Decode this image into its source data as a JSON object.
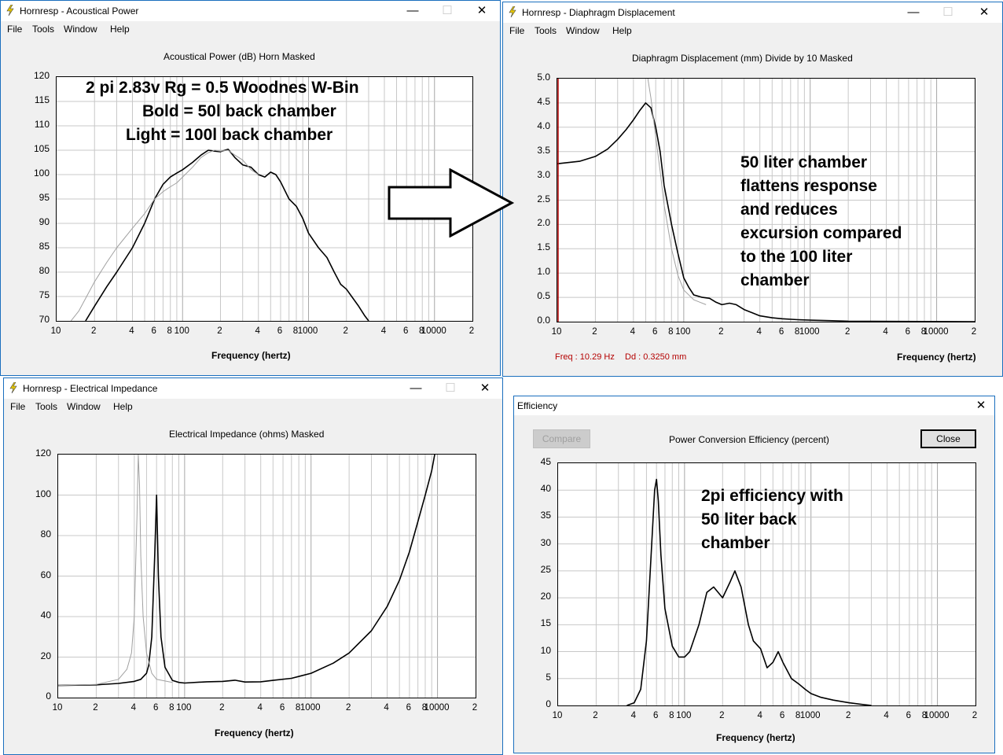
{
  "windows": {
    "acoustical": {
      "title": "Hornresp - Acoustical Power",
      "menu": [
        "File",
        "Tools",
        "Window",
        "Help"
      ],
      "chart_title": "Acoustical Power (dB)   Horn   Masked",
      "x_axis_title": "Frequency (hertz)",
      "annotation": [
        "2 pi 2.83v  Rg = 0.5  Woodnes W-Bin",
        "Bold = 50l back chamber",
        "Light = 100l back chamber"
      ]
    },
    "displacement": {
      "title": "Hornresp - Diaphragm Displacement",
      "menu": [
        "File",
        "Tools",
        "Window",
        "Help"
      ],
      "chart_title": "Diaphragm Displacement (mm)   Divide by 10   Masked",
      "x_axis_title": "Frequency (hertz)",
      "status_freq": "Freq : 10.29 Hz",
      "status_dd": "Dd : 0.3250 mm",
      "annotation": [
        "50 liter chamber",
        "flattens response",
        "and reduces",
        "excursion compared",
        "to the 100 liter",
        "chamber"
      ]
    },
    "impedance": {
      "title": "Hornresp - Electrical Impedance",
      "menu": [
        "File",
        "Tools",
        "Window",
        "Help"
      ],
      "chart_title": "Electrical Impedance (ohms)   Masked",
      "x_axis_title": "Frequency (hertz)"
    },
    "efficiency": {
      "title": "Efficiency",
      "chart_title": "Power Conversion Efficiency (percent)",
      "compare_label": "Compare",
      "close_label": "Close",
      "x_axis_title": "Frequency (hertz)",
      "annotation": [
        "2pi efficiency with",
        "50 liter back",
        "chamber"
      ]
    }
  },
  "colors": {
    "title_border": "#1a6fbe",
    "client_bg": "#f0f0f0",
    "grid": "#c8c8c8",
    "trace_bold": "#000000",
    "trace_light": "#a0a0a0",
    "status": "#b40000"
  },
  "x_tick_labels": [
    "10",
    "2",
    "4",
    "6",
    "8",
    "100",
    "2",
    "4",
    "6",
    "8",
    "1000",
    "2",
    "4",
    "6",
    "8",
    "10000",
    "2"
  ],
  "chart_data": [
    {
      "id": "acoustical",
      "type": "line",
      "title": "Acoustical Power (dB)   Horn   Masked",
      "xlabel": "Frequency (hertz)",
      "xscale": "log",
      "xlim": [
        10,
        20000
      ],
      "ylim": [
        70,
        120
      ],
      "y_ticks": [
        "120",
        "115",
        "110",
        "105",
        "100",
        "95",
        "90",
        "85",
        "80",
        "75",
        "70"
      ],
      "grid": true,
      "series": [
        {
          "style": "bold",
          "x": [
            17,
            20,
            25,
            30,
            40,
            50,
            60,
            70,
            80,
            90,
            100,
            120,
            140,
            160,
            180,
            200,
            230,
            260,
            300,
            350,
            400,
            450,
            500,
            550,
            600,
            700,
            800,
            900,
            1000,
            1200,
            1400,
            1600,
            1800,
            2000,
            2200,
            2500,
            2800,
            3000
          ],
          "y": [
            70,
            73,
            77,
            80,
            85,
            90,
            95,
            98,
            99.5,
            100.3,
            101,
            102.5,
            104,
            105,
            104.8,
            104.7,
            105.2,
            103.5,
            102,
            101.5,
            100,
            99.5,
            100.5,
            100,
            98.5,
            95,
            93.5,
            91,
            88,
            85,
            83,
            80,
            77.5,
            76.5,
            75,
            73,
            71,
            70
          ]
        },
        {
          "style": "light",
          "x": [
            13,
            15,
            20,
            25,
            30,
            40,
            50,
            60,
            70,
            80,
            90,
            100,
            120,
            140,
            160,
            180,
            200,
            230,
            260,
            300,
            350,
            400
          ],
          "y": [
            70,
            72,
            78,
            82,
            85,
            89,
            92,
            95,
            96.5,
            97.5,
            98.3,
            99.5,
            101.5,
            103.5,
            104.5,
            105,
            104.8,
            105,
            104,
            103,
            101,
            100
          ]
        }
      ]
    },
    {
      "id": "displacement",
      "type": "line",
      "title": "Diaphragm Displacement (mm)   Divide by 10   Masked",
      "xlabel": "Frequency (hertz)",
      "xscale": "log",
      "xlim": [
        10,
        20000
      ],
      "ylim": [
        0,
        5
      ],
      "y_ticks": [
        "5.0",
        "4.5",
        "4.0",
        "3.5",
        "3.0",
        "2.5",
        "2.0",
        "1.5",
        "1.0",
        "0.5",
        "0.0"
      ],
      "grid": true,
      "series": [
        {
          "style": "bold",
          "x": [
            10,
            15,
            20,
            25,
            30,
            35,
            40,
            45,
            50,
            55,
            60,
            65,
            70,
            80,
            90,
            100,
            110,
            120,
            140,
            160,
            180,
            200,
            230,
            260,
            300,
            350,
            400,
            500,
            600,
            800,
            1000,
            1500,
            2000,
            5000,
            20000
          ],
          "y": [
            3.25,
            3.3,
            3.4,
            3.55,
            3.75,
            3.95,
            4.15,
            4.35,
            4.5,
            4.4,
            4.0,
            3.5,
            2.8,
            2.0,
            1.4,
            0.9,
            0.7,
            0.55,
            0.5,
            0.48,
            0.4,
            0.35,
            0.38,
            0.35,
            0.25,
            0.18,
            0.12,
            0.08,
            0.06,
            0.04,
            0.03,
            0.02,
            0.01,
            0.005,
            0.0
          ]
        },
        {
          "style": "light",
          "x": [
            52,
            55,
            60,
            65,
            70,
            80,
            90,
            100,
            120,
            150
          ],
          "y": [
            5.0,
            4.6,
            3.8,
            3.1,
            2.4,
            1.5,
            0.95,
            0.65,
            0.45,
            0.35
          ]
        }
      ]
    },
    {
      "id": "impedance",
      "type": "line",
      "title": "Electrical Impedance (ohms)   Masked",
      "xlabel": "Frequency (hertz)",
      "xscale": "log",
      "xlim": [
        10,
        20000
      ],
      "ylim": [
        0,
        120
      ],
      "y_ticks": [
        "120",
        "100",
        "80",
        "60",
        "40",
        "20",
        "0"
      ],
      "grid": true,
      "series": [
        {
          "style": "bold",
          "x": [
            10,
            20,
            30,
            40,
            45,
            50,
            52,
            55,
            58,
            60,
            62,
            65,
            70,
            80,
            90,
            100,
            150,
            200,
            250,
            300,
            400,
            500,
            700,
            1000,
            1500,
            2000,
            3000,
            4000,
            5000,
            6000,
            7000,
            8000,
            9000,
            9500
          ],
          "y": [
            6,
            6.3,
            7,
            8,
            9,
            12,
            16,
            30,
            70,
            100,
            60,
            30,
            15,
            8.5,
            7.5,
            7.2,
            7.8,
            8,
            8.6,
            7.7,
            7.8,
            8.5,
            9.5,
            12,
            17,
            22,
            33,
            45,
            58,
            72,
            87,
            100,
            112,
            120
          ]
        },
        {
          "style": "light",
          "x": [
            10,
            20,
            30,
            35,
            38,
            40,
            42,
            43,
            44,
            45,
            47,
            50,
            55,
            60,
            80
          ],
          "y": [
            6,
            6.5,
            9,
            14,
            22,
            40,
            90,
            120,
            105,
            70,
            40,
            22,
            12,
            9,
            7.5
          ]
        }
      ]
    },
    {
      "id": "efficiency",
      "type": "line",
      "title": "Power Conversion Efficiency (percent)",
      "xlabel": "Frequency (hertz)",
      "xscale": "log",
      "xlim": [
        10,
        20000
      ],
      "ylim": [
        0,
        45
      ],
      "y_ticks": [
        "45",
        "40",
        "35",
        "30",
        "25",
        "20",
        "15",
        "10",
        "5",
        "0"
      ],
      "grid": true,
      "series": [
        {
          "style": "bold",
          "x": [
            35,
            40,
            45,
            50,
            55,
            58,
            60,
            62,
            65,
            70,
            80,
            90,
            100,
            110,
            130,
            150,
            170,
            200,
            230,
            250,
            280,
            320,
            350,
            400,
            450,
            500,
            550,
            600,
            700,
            800,
            900,
            1000,
            1200,
            1500,
            2000,
            2500,
            3000
          ],
          "y": [
            0,
            0.5,
            3,
            12,
            30,
            40,
            42,
            38,
            28,
            18,
            11,
            9,
            9,
            10,
            15,
            21,
            22,
            20,
            23,
            25,
            22,
            15,
            12,
            10.5,
            7,
            8,
            10,
            8,
            5,
            4,
            3,
            2.2,
            1.5,
            1,
            0.5,
            0.2,
            0
          ]
        }
      ]
    }
  ]
}
